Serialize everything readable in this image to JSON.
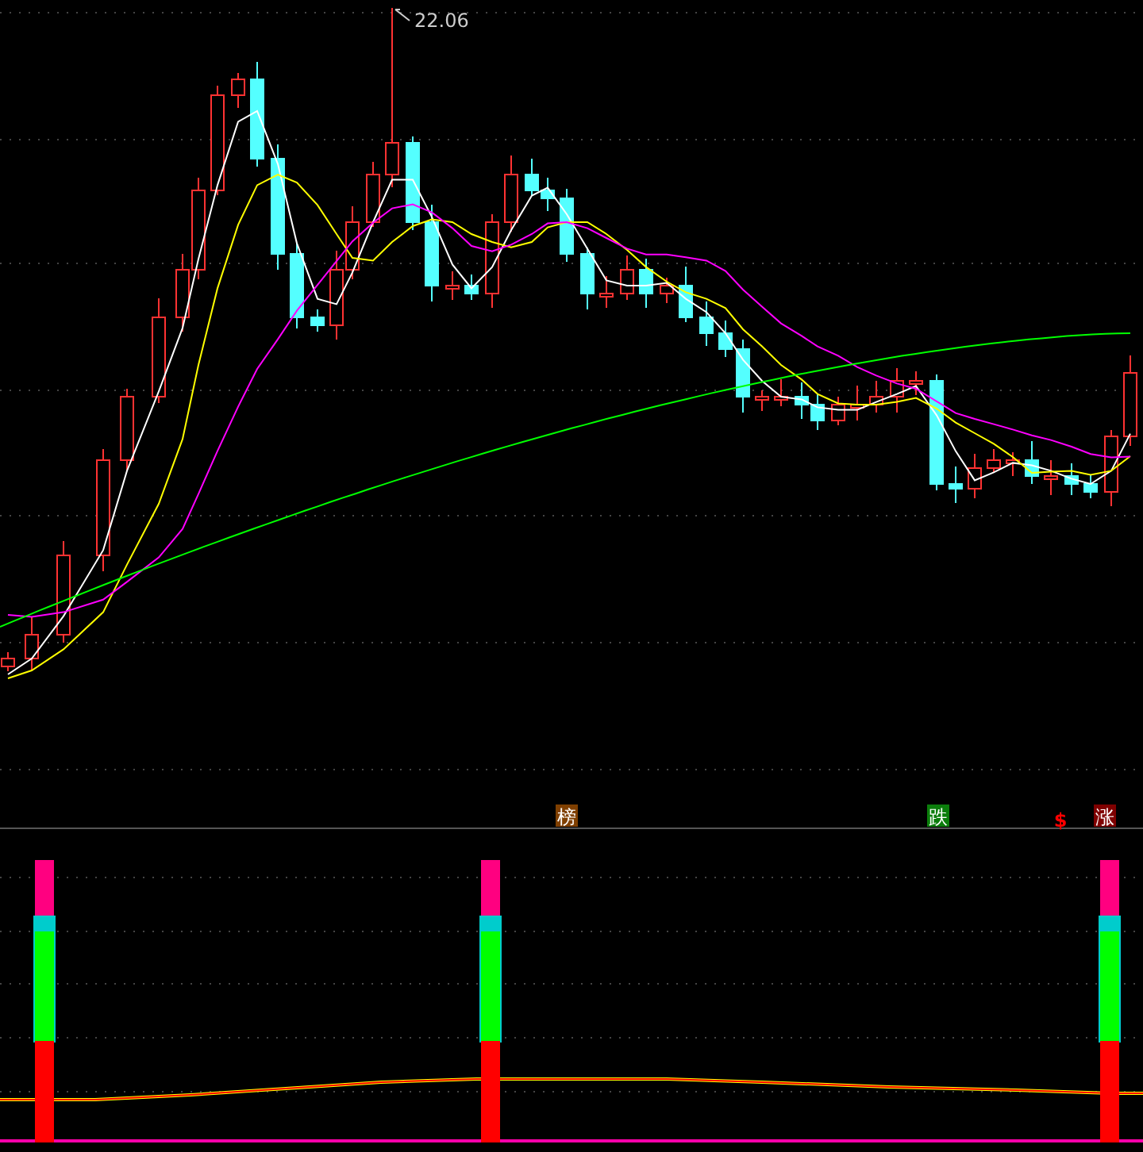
{
  "price_chart": {
    "high_label": "22.06"
  },
  "signals": [
    {
      "kind": "badge",
      "text": "榜",
      "color": "#7f3f00"
    },
    {
      "kind": "badge",
      "text": "跌",
      "color": "#0b7d0b"
    },
    {
      "kind": "marker",
      "text": "$",
      "color": "#ff0000"
    },
    {
      "kind": "badge",
      "text": "涨",
      "color": "#7f0000"
    }
  ]
}
